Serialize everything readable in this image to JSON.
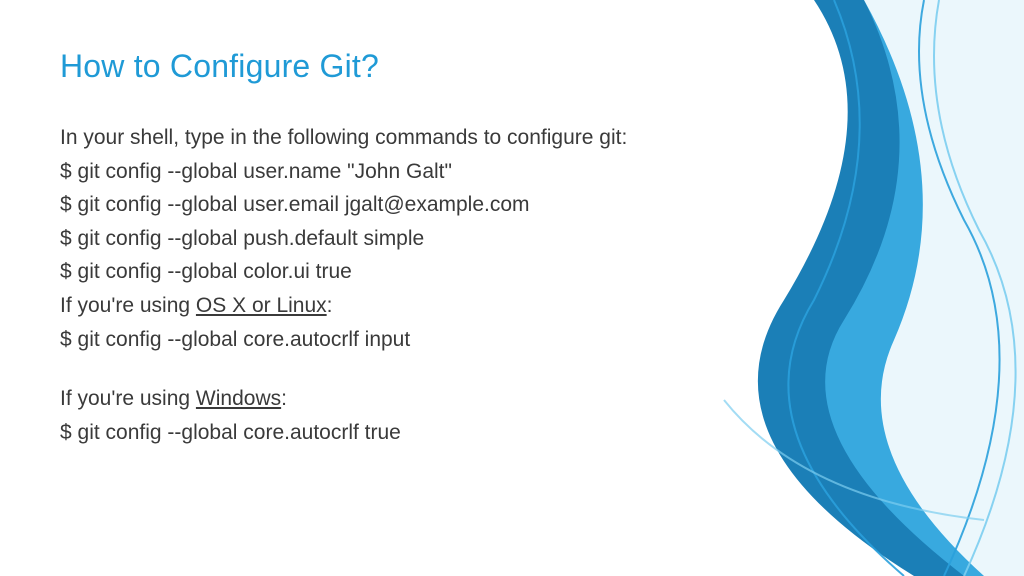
{
  "title": "How to Configure Git?",
  "intro": "In your shell, type in the following commands to configure git:",
  "cmd1": "$ git config --global user.name \"John Galt\"",
  "cmd2": "$ git config --global user.email jgalt@example.com",
  "cmd3": "$ git config --global push.default simple",
  "cmd4": "$ git config --global color.ui true",
  "osxlinux_pre": "If you're using ",
  "osxlinux_u": "OS X or Linux",
  "osxlinux_post": ":",
  "cmd5": "$ git config --global core.autocrlf input",
  "windows_pre": "If you're using ",
  "windows_u": "Windows",
  "windows_post": ":",
  "cmd6": "$ git config --global core.autocrlf true"
}
